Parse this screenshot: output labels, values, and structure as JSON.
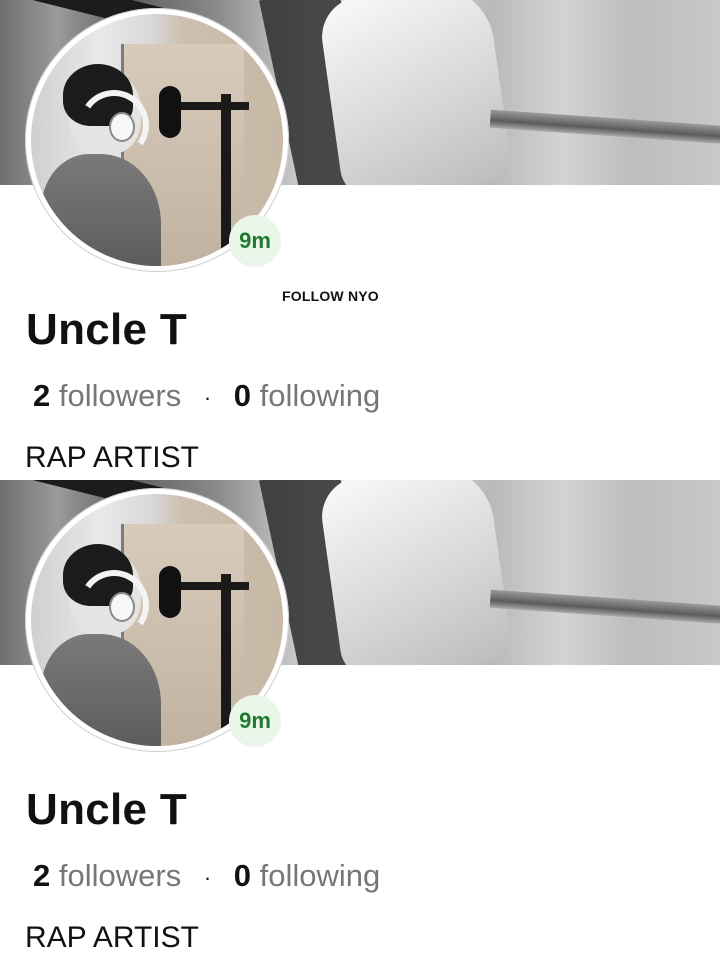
{
  "profiles": [
    {
      "time_badge": "9m",
      "follow_text": "FOLLOW NYO",
      "name": "Uncle T",
      "followers_count": "2",
      "followers_label": "followers",
      "separator": "·",
      "following_count": "0",
      "following_label": "following",
      "bio": "RAP ARTIST"
    },
    {
      "time_badge": "9m",
      "follow_text": "",
      "name": "Uncle T",
      "followers_count": "2",
      "followers_label": "followers",
      "separator": "·",
      "following_count": "0",
      "following_label": "following",
      "bio": "RAP ARTIST"
    }
  ],
  "colors": {
    "time_badge_bg": "#e9f6e9",
    "time_badge_text": "#1f7a2f",
    "muted_text": "#777777"
  }
}
